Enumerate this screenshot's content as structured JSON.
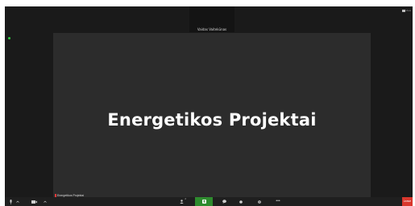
{
  "gallery": {
    "participant_name": "Vaidas Vaitekūnas"
  },
  "view": {
    "label": "View"
  },
  "share": {
    "title": "Energetikos Projektai",
    "presenter_name": "Energetikos Projektai"
  },
  "toolbar": {
    "participants_count": "2",
    "more_label": "•••",
    "end_label": "Leave",
    "icons": [
      "mic-icon",
      "chevron-up-icon",
      "video-icon",
      "chevron-up-icon",
      "participants-icon",
      "share-screen-icon",
      "chat-icon",
      "record-icon",
      "reactions-icon",
      "more-icon"
    ]
  },
  "colors": {
    "app_bg": "#1a1a1a",
    "share_bg": "#2c2c2c",
    "toolbar_bg": "#1f1f1f",
    "share_accent": "#2e8b2e",
    "end_red": "#d9372d",
    "status_green": "#2ecc40"
  }
}
